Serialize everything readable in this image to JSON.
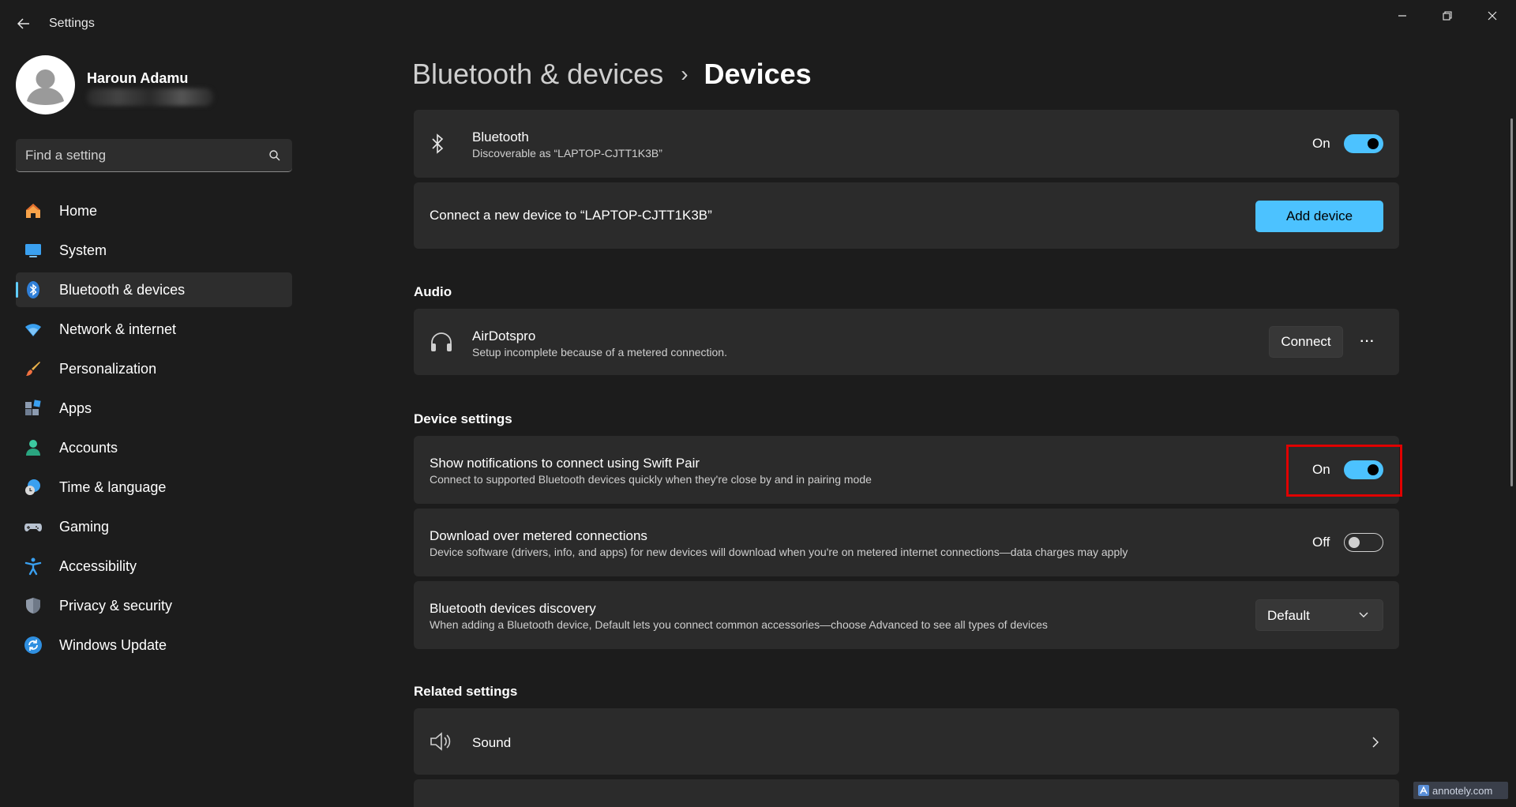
{
  "window": {
    "app_title": "Settings"
  },
  "profile": {
    "name": "Haroun Adamu"
  },
  "search": {
    "placeholder": "Find a setting"
  },
  "sidebar": {
    "items": [
      {
        "label": "Home",
        "icon": "home-icon"
      },
      {
        "label": "System",
        "icon": "system-icon"
      },
      {
        "label": "Bluetooth & devices",
        "icon": "bluetooth-icon",
        "active": true
      },
      {
        "label": "Network & internet",
        "icon": "wifi-icon"
      },
      {
        "label": "Personalization",
        "icon": "brush-icon"
      },
      {
        "label": "Apps",
        "icon": "apps-icon"
      },
      {
        "label": "Accounts",
        "icon": "accounts-icon"
      },
      {
        "label": "Time & language",
        "icon": "time-language-icon"
      },
      {
        "label": "Gaming",
        "icon": "gamepad-icon"
      },
      {
        "label": "Accessibility",
        "icon": "accessibility-icon"
      },
      {
        "label": "Privacy & security",
        "icon": "shield-icon"
      },
      {
        "label": "Windows Update",
        "icon": "update-icon"
      }
    ]
  },
  "breadcrumb": {
    "parent": "Bluetooth & devices",
    "separator": "›",
    "current": "Devices"
  },
  "bluetooth": {
    "title": "Bluetooth",
    "subtitle": "Discoverable as “LAPTOP-CJTT1K3B”",
    "state": "On",
    "enabled": true
  },
  "add_device": {
    "text": "Connect a new device to “LAPTOP-CJTT1K3B”",
    "button": "Add device"
  },
  "audio": {
    "section_label": "Audio",
    "device": {
      "name": "AirDotspro",
      "status": "Setup incomplete because of a metered connection.",
      "connect_button": "Connect",
      "more_label": "···"
    }
  },
  "device_settings": {
    "section_label": "Device settings",
    "swift_pair": {
      "title": "Show notifications to connect using Swift Pair",
      "subtitle": "Connect to supported Bluetooth devices quickly when they're close by and in pairing mode",
      "state": "On",
      "enabled": true
    },
    "metered": {
      "title": "Download over metered connections",
      "subtitle": "Device software (drivers, info, and apps) for new devices will download when you're on metered internet connections—data charges may apply",
      "state": "Off",
      "enabled": false
    },
    "discovery": {
      "title": "Bluetooth devices discovery",
      "subtitle": "When adding a Bluetooth device, Default lets you connect common accessories—choose Advanced to see all types of devices",
      "selected": "Default"
    }
  },
  "related_settings": {
    "section_label": "Related settings",
    "items": [
      {
        "label": "Sound",
        "icon": "speaker-icon"
      }
    ]
  },
  "watermark": {
    "text": "annotely.com"
  },
  "colors": {
    "accent": "#4cc2ff",
    "background": "#1c1c1c",
    "card": "#2b2b2b",
    "highlight": "#e00000"
  }
}
